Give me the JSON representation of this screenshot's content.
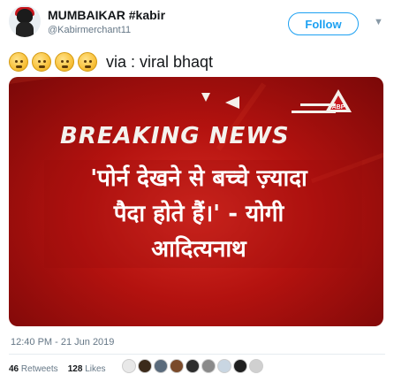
{
  "author": {
    "name": "MUMBAIKAR #kabir",
    "handle": "@Kabirmerchant11",
    "follow_label": "Follow",
    "more_icon": "chevron-down-icon"
  },
  "tweet": {
    "emojis": [
      "sad-face-emoji",
      "sad-face-emoji",
      "sad-face-emoji",
      "sad-face-emoji"
    ],
    "text": "via : viral bhaqt"
  },
  "media": {
    "breaking_left": "BREAKING",
    "breaking_right": "NEWS",
    "channel_logo": "ABP",
    "headline_lines": [
      "'पोर्न देखने से बच्चे ज़्यादा",
      "पैदा होते हैं।' - योगी",
      "आदित्यनाथ"
    ],
    "colors": {
      "background": "#b3120f",
      "text": "#ffffff"
    }
  },
  "meta": {
    "timestamp": "12:40 PM - 21 Jun 2019"
  },
  "stats": {
    "retweets_count": "46",
    "retweets_label": "Retweets",
    "likes_count": "128",
    "likes_label": "Likes",
    "liker_avatars": 9
  }
}
